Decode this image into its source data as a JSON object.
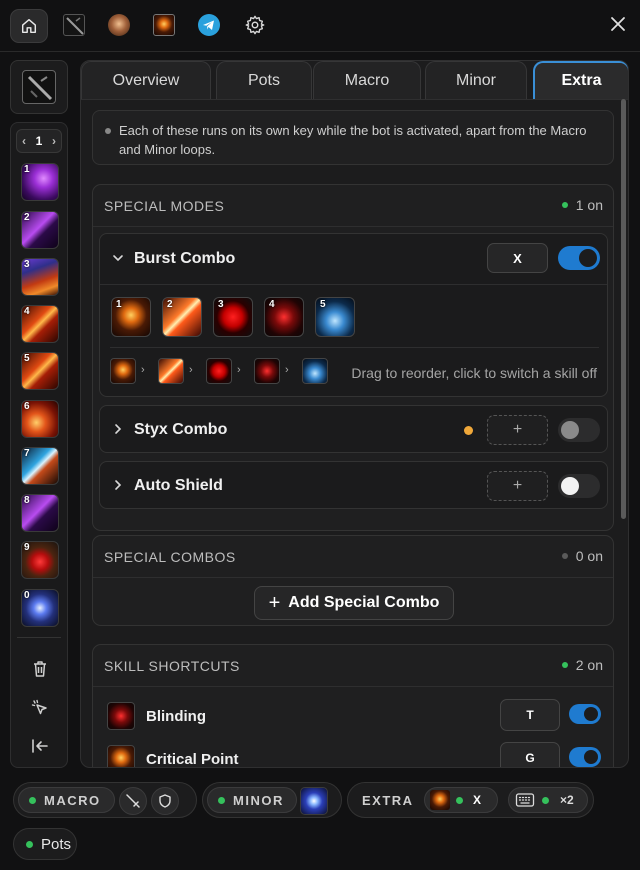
{
  "topbar": {
    "icons": [
      "home-icon",
      "weapon-icon",
      "character-icon",
      "fire-icon",
      "telegram-icon",
      "gear-icon",
      "close-icon"
    ],
    "close_glyph": "✕"
  },
  "rail": {
    "page": "1",
    "slots": [
      {
        "num": "1",
        "art": "art-purple"
      },
      {
        "num": "2",
        "art": "art-purple2"
      },
      {
        "num": "3",
        "art": "art-mix"
      },
      {
        "num": "4",
        "art": "art-fire"
      },
      {
        "num": "5",
        "art": "art-fire"
      },
      {
        "num": "6",
        "art": "art-fire2"
      },
      {
        "num": "7",
        "art": "art-blue"
      },
      {
        "num": "8",
        "art": "art-purple2"
      },
      {
        "num": "9",
        "art": "art-potion"
      },
      {
        "num": "0",
        "art": "art-gem"
      }
    ]
  },
  "tabs": [
    {
      "label": "Overview",
      "active": false
    },
    {
      "label": "Pots",
      "active": false
    },
    {
      "label": "Macro",
      "active": false
    },
    {
      "label": "Minor",
      "active": false
    },
    {
      "label": "Extra",
      "active": true
    }
  ],
  "info": {
    "text": "Each of these runs on its own key while the bot is activated, apart from the Macro and Minor loops."
  },
  "special_modes": {
    "title": "SPECIAL MODES",
    "count": "1 on",
    "count_color": "#35c15c",
    "modes": [
      {
        "name": "Burst Combo",
        "key": "X",
        "enabled": true,
        "expanded": true,
        "skills": [
          {
            "num": "1",
            "art": "art-demon"
          },
          {
            "num": "2",
            "art": "art-slash"
          },
          {
            "num": "3",
            "art": "art-blood"
          },
          {
            "num": "4",
            "art": "art-eye"
          },
          {
            "num": "5",
            "art": "art-ghost"
          }
        ],
        "hint": "Drag to reorder, click to switch a skill off"
      },
      {
        "name": "Styx Combo",
        "key": "+",
        "enabled": false,
        "expanded": false,
        "pending": true
      },
      {
        "name": "Auto Shield",
        "key": "+",
        "enabled": false,
        "expanded": false
      }
    ]
  },
  "special_combos": {
    "title": "SPECIAL COMBOS",
    "count": "0 on",
    "count_color": "#5a5a5a",
    "add_label": "Add Special Combo",
    "add_glyph": "+"
  },
  "skill_shortcuts": {
    "title": "SKILL SHORTCUTS",
    "count": "2 on",
    "count_color": "#35c15c",
    "items": [
      {
        "name": "Blinding",
        "key": "T",
        "enabled": true,
        "art": "art-eye"
      },
      {
        "name": "Critical Point",
        "key": "G",
        "enabled": true,
        "art": "art-demon"
      }
    ]
  },
  "statusbar": {
    "macro_label": "MACRO",
    "minor_label": "MINOR",
    "extra_label": "EXTRA",
    "extra_key": "X",
    "keyboard_count": "×2",
    "pots_label": "Pots",
    "dot_color": "#35c15c"
  }
}
